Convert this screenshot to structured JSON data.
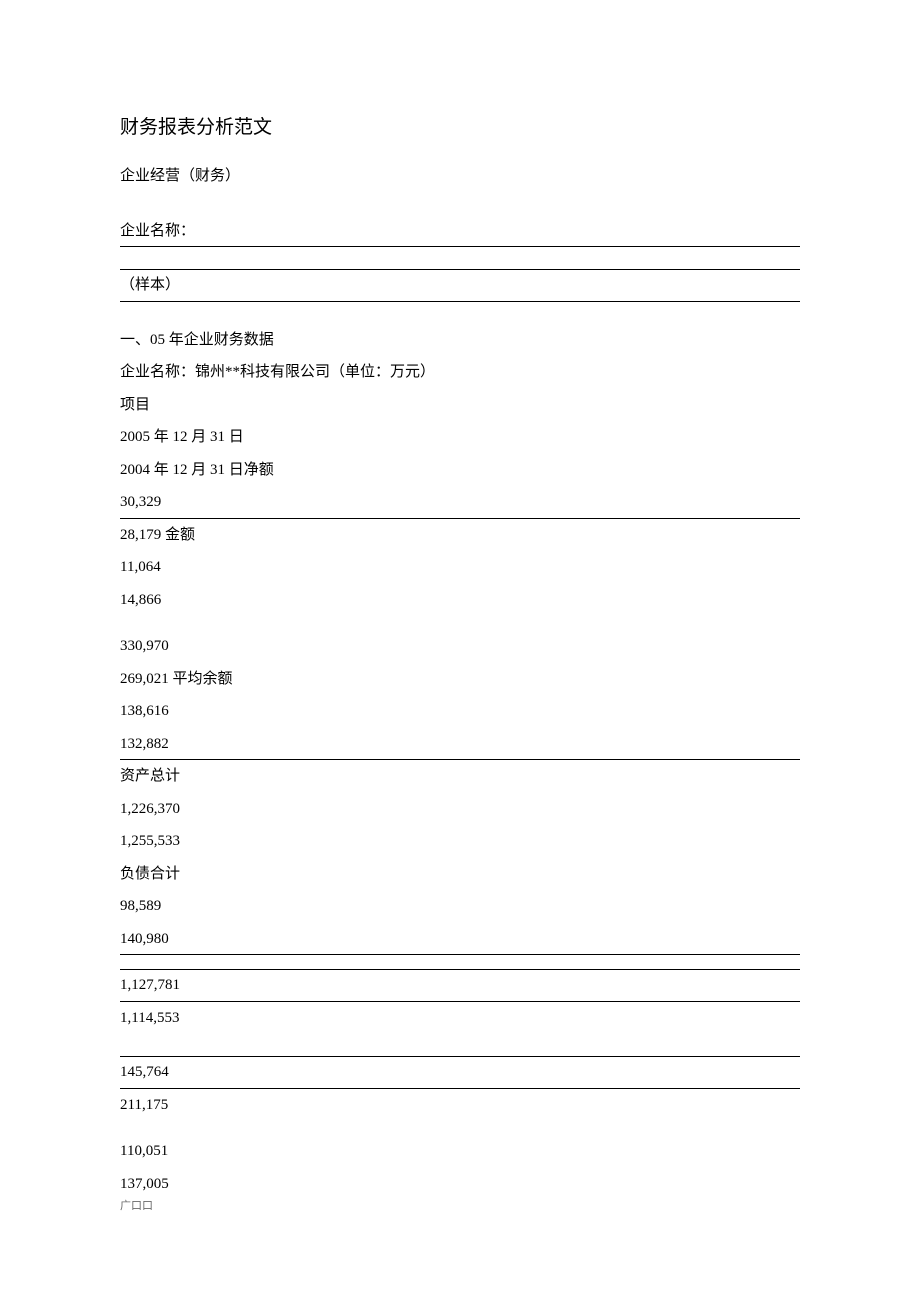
{
  "title": "财务报表分析范文",
  "subtitle": "企业经营（财务）",
  "companyLabel": "企业名称：",
  "sample": "（样本）",
  "section1": "一、05 年企业财务数据",
  "companyLine": "企业名称：锦州**科技有限公司（单位：万元）",
  "lines": {
    "item": "项目",
    "date2005": "2005 年 12 月 31 日",
    "date2004": "2004 年 12 月 31 日净额",
    "v1": "30,329",
    "v2": "28,179 金额",
    "v3": "11,064",
    "v4": "14,866",
    "v5": "330,970",
    "v6": "269,021 平均余额",
    "v7": "138,616",
    "v8": "132,882",
    "assetTotal": "资产总计",
    "v9": "1,226,370",
    "v10": "1,255,533",
    "liabTotal": "负债合计",
    "v11": "98,589",
    "v12": "140,980",
    "v13": "1,127,781",
    "v14": "1,114,553",
    "v15": "145,764",
    "v16": "211,175",
    "v17": "110,051",
    "v18": "137,005",
    "footer": "广口口"
  }
}
